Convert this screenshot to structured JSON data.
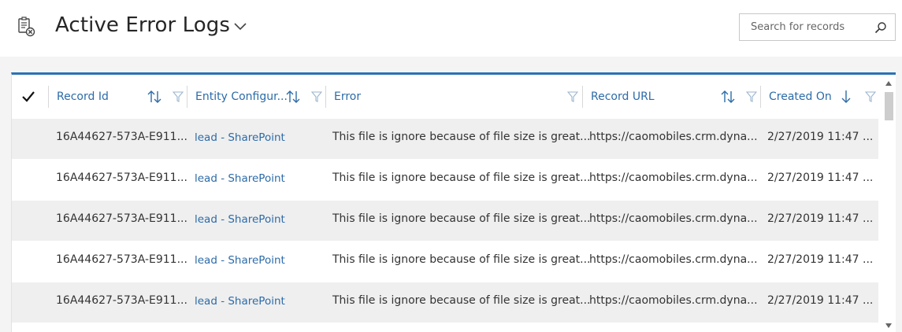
{
  "header": {
    "title": "Active Error Logs",
    "view_icon": "error-log-icon",
    "search_placeholder": "Search for records"
  },
  "columns": [
    {
      "label": "Record Id",
      "sortable": true,
      "filter": true
    },
    {
      "label": "Entity Configur...",
      "sortable": true,
      "filter": true
    },
    {
      "label": "Error",
      "sortable": false,
      "filter": true
    },
    {
      "label": "Record URL",
      "sortable": true,
      "filter": true
    },
    {
      "label": "Created On",
      "sort": "descending",
      "filter": true
    }
  ],
  "rows": [
    {
      "record_id": "16A44627-573A-E911...",
      "entity": "lead - SharePoint",
      "error": "This file is ignore because of file size is great...",
      "url": "https://caomobiles.crm.dyna...",
      "created": "2/27/2019 11:47 ..."
    },
    {
      "record_id": "16A44627-573A-E911...",
      "entity": "lead - SharePoint",
      "error": "This file is ignore because of file size is great...",
      "url": "https://caomobiles.crm.dyna...",
      "created": "2/27/2019 11:47 ..."
    },
    {
      "record_id": "16A44627-573A-E911...",
      "entity": "lead - SharePoint",
      "error": "This file is ignore because of file size is great...",
      "url": "https://caomobiles.crm.dyna...",
      "created": "2/27/2019 11:47 ..."
    },
    {
      "record_id": "16A44627-573A-E911...",
      "entity": "lead - SharePoint",
      "error": "This file is ignore because of file size is great...",
      "url": "https://caomobiles.crm.dyna...",
      "created": "2/27/2019 11:47 ..."
    },
    {
      "record_id": "16A44627-573A-E911...",
      "entity": "lead - SharePoint",
      "error": "This file is ignore because of file size is great...",
      "url": "https://caomobiles.crm.dyna...",
      "created": "2/27/2019 11:47 ..."
    }
  ],
  "colors": {
    "accent": "#2a72b5",
    "link": "#2c6ba8",
    "row_alt": "#efefef"
  }
}
